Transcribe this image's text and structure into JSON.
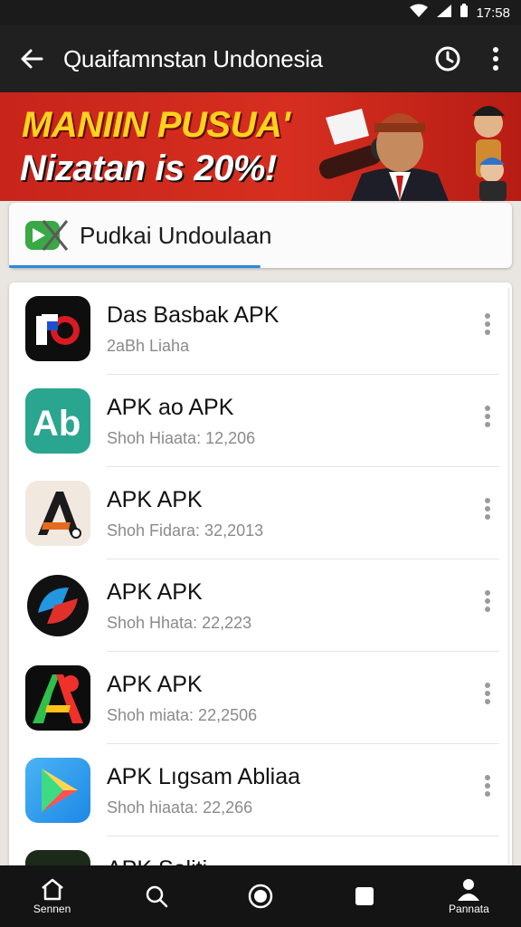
{
  "status_bar": {
    "time": "17:58"
  },
  "app_bar": {
    "title": "Quaifamnstan Undonesia"
  },
  "banner": {
    "line1": "MANIIN PUSUA'",
    "line2": "Nizatan is 20%!"
  },
  "search": {
    "label": "Pudkai Undoulaan"
  },
  "apps": [
    {
      "name": "Das Basbak APK",
      "meta": "2aBh Liaha",
      "icon": "pix-icon"
    },
    {
      "name": "APK ao APK",
      "meta": "Shoh Hiaata: 12,206",
      "icon": "ab-icon"
    },
    {
      "name": "APK APK",
      "meta": "Shoh Fidara: 32,2013",
      "icon": "a-letter-icon"
    },
    {
      "name": "APK APK",
      "meta": "Shoh Hhata: 22,223",
      "icon": "red-blue-swirl-icon"
    },
    {
      "name": "APK APK",
      "meta": "Shoh miata: 22,2506",
      "icon": "colorful-a-icon"
    },
    {
      "name": "APK Lıgsam Abliaa",
      "meta": "Shoh hiaata: 22,266",
      "icon": "play-store-icon"
    },
    {
      "name": "APK Soliti",
      "meta": "",
      "icon": "dark-app-icon"
    }
  ],
  "bottom_nav": [
    {
      "label": "Sennen",
      "icon": "home-icon"
    },
    {
      "label": "",
      "icon": "search-icon"
    },
    {
      "label": "",
      "icon": "circle-button-icon"
    },
    {
      "label": "",
      "icon": "square-icon"
    },
    {
      "label": "Pannata",
      "icon": "profile-icon"
    }
  ],
  "colors": {
    "banner_red": "#d62f20",
    "banner_yellow": "#ffd21f",
    "progress_blue": "#2e86de",
    "app_bar": "#202020"
  }
}
